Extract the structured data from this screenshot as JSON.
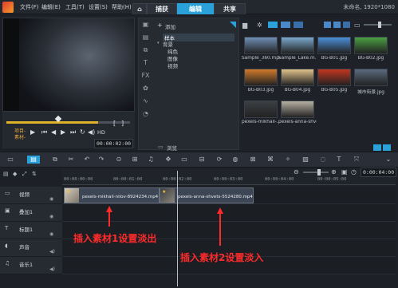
{
  "menu": [
    "文件(F)",
    "编辑(E)",
    "工具(T)",
    "设置(S)",
    "帮助(H)"
  ],
  "tabs": {
    "home": "⌂",
    "capture": "捕获",
    "edit": "编辑",
    "share": "共享"
  },
  "window_title": "未命名, 1920*1080",
  "preview": {
    "labels": [
      "项目-",
      "素材-"
    ],
    "hd": "HD",
    "timecode": "00:00:02:00"
  },
  "library": {
    "add_label": "添加",
    "tree": [
      "样本",
      "背景",
      "纯色",
      "图像",
      "视频"
    ],
    "browse_label": "浏览"
  },
  "media": [
    {
      "label": "Sample_360.mp4",
      "color": "#6f8fb5"
    },
    {
      "label": "Sample_Lake.m...",
      "color": "#7aa8cc"
    },
    {
      "label": "BG-B01.jpg",
      "color": "#4b8fd8"
    },
    {
      "label": "BG-B02.jpg",
      "color": "#4aa043"
    },
    {
      "label": "BG-B03.jpg",
      "color": "#d07a2a"
    },
    {
      "label": "BG-B04.jpg",
      "color": "#e0c28a"
    },
    {
      "label": "BG-B05.jpg",
      "color": "#c2361f"
    },
    {
      "label": "城市街景.jpg",
      "color": "#5a6a7e"
    },
    {
      "label": "pexels-mikhail-...",
      "color": "#3c3f44"
    },
    {
      "label": "pexels-anna-shve...",
      "color": "#b7b0a3"
    }
  ],
  "ruler": [
    "00:00:00:00",
    "00:00:01:00",
    "00:00:02:00",
    "00:00:03:00",
    "00:00:04:00",
    "00:00:05:00"
  ],
  "zoom_timecode": "0:00:04:00",
  "tracks": [
    "视频",
    "叠加1",
    "标题1",
    "声音",
    "音乐1"
  ],
  "clips": [
    {
      "label": "pexels-mikhail-nilov-8924234.mp4"
    },
    {
      "label": "pexels-anna-shvets-5524280.mp4"
    }
  ],
  "annotations": [
    "插入素材1设置淡出",
    "插入素材2设置淡入"
  ]
}
